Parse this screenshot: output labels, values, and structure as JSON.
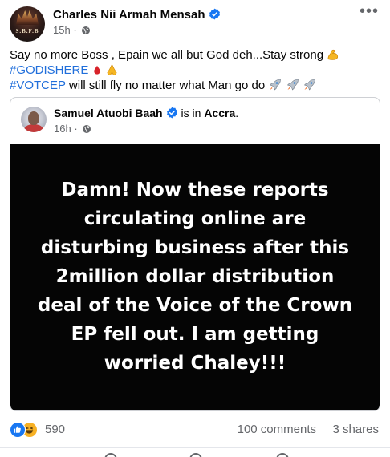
{
  "post": {
    "author": "Charles Nii Armah Mensah",
    "avatar_tag": "S.B.F.B",
    "time": "15h",
    "audience_icon": "globe-icon",
    "more_icon": "more-options-icon",
    "more_label": "•••",
    "caption": {
      "line1": "Say no more Boss , Epain we all but God deh...Stay strong",
      "hashtag1": "#GODISHERE",
      "hashtag2": "#VOTCEP",
      "line3_rest": " will still fly no matter what Man go do",
      "emoji_line1": "flexed-biceps-emoji",
      "emoji_line2": [
        "drop-of-blood-emoji",
        "folded-hands-emoji"
      ],
      "emoji_line3": [
        "rocket-emoji",
        "rocket-emoji",
        "rocket-emoji"
      ]
    }
  },
  "shared_post": {
    "author": "Samuel Atuobi Baah",
    "location_prefix": " is in ",
    "location": "Accra",
    "location_suffix": ".",
    "time": "16h",
    "quote_lines": [
      "Damn! Now these reports",
      "circulating online are",
      "disturbing business after this",
      "2million dollar distribution",
      "deal of the Voice of the Crown",
      "EP fell out. I am getting",
      "worried Chaley!!!"
    ]
  },
  "engagement": {
    "reaction_icons": [
      "like-icon",
      "haha-icon"
    ],
    "reaction_count": "590",
    "comments": "100 comments",
    "shares": "3 shares"
  },
  "colors": {
    "hashtag": "#216fdb",
    "verified": "#1877f2",
    "secondary_text": "#65676b",
    "quote_background": "#050505"
  }
}
